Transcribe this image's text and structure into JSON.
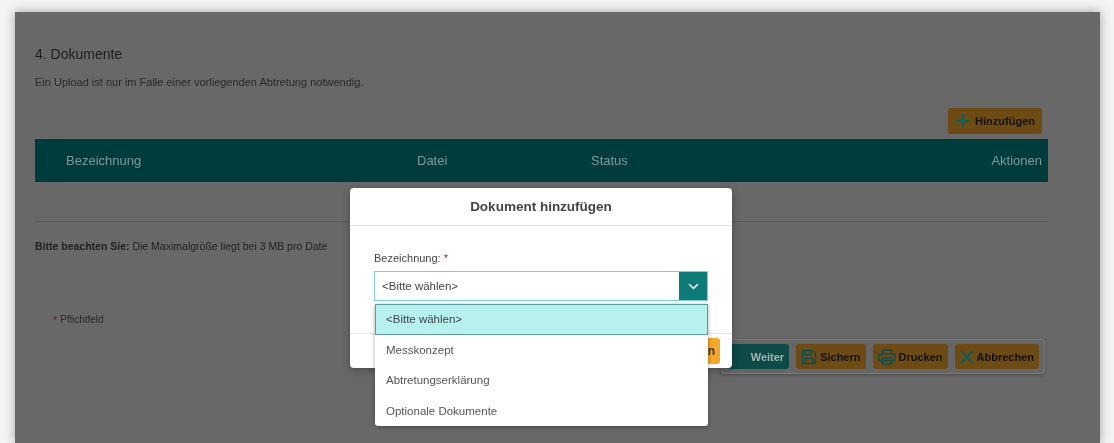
{
  "section": {
    "title": "4. Dokumente",
    "description": "Ein Upload ist nur im Falle einer vorliegenden Abtretung notwendig.",
    "add_button": "Hinzufügen",
    "table": {
      "columns": [
        "Bezeichnung",
        "Datei",
        "Status",
        "Aktionen"
      ]
    },
    "note": "**Bitte beachten Sie:** Die Maximalgröße liegt bei 3 MB pro Date",
    "required_hint": {
      "marker": "*",
      "label": "Pflichtfeld"
    }
  },
  "toolbar": [
    {
      "kind": "next",
      "label": "Weiter"
    },
    {
      "kind": "save",
      "label": "Sichern"
    },
    {
      "kind": "print",
      "label": "Drucken"
    },
    {
      "kind": "cancel",
      "label": "Abbrechen"
    }
  ],
  "modal": {
    "title": "Dokument hinzufügen",
    "field": {
      "label": "Bezeichnung:",
      "required_marker": "*",
      "value": "<Bitte wählen>",
      "options": [
        {
          "label": "<Bitte wählen>",
          "selected": true
        },
        {
          "label": "Messkonzept",
          "selected": false
        },
        {
          "label": "Abtretungserklärung",
          "selected": false
        },
        {
          "label": "Optionale Dokumente",
          "selected": false
        }
      ]
    },
    "footer_button": "n"
  }
}
